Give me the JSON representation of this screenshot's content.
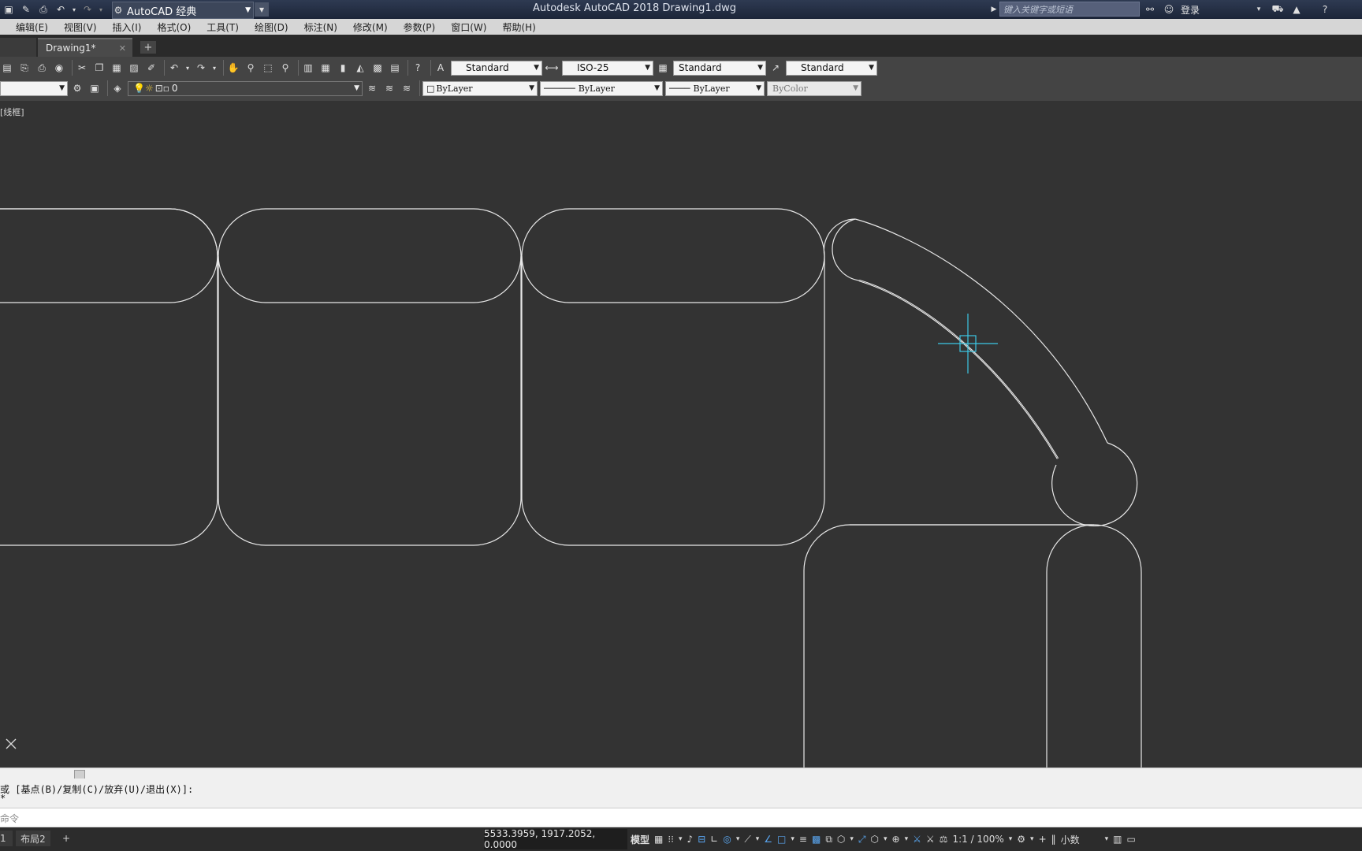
{
  "window": {
    "title": "Autodesk AutoCAD 2018    Drawing1.dwg",
    "workspace": "AutoCAD 经典",
    "search_placeholder": "键入关键字或短语",
    "login": "登录"
  },
  "menu": [
    "编辑(E)",
    "视图(V)",
    "插入(I)",
    "格式(O)",
    "工具(T)",
    "绘图(D)",
    "标注(N)",
    "修改(M)",
    "参数(P)",
    "窗口(W)",
    "帮助(H)"
  ],
  "tabs": {
    "active": "Drawing1*",
    "add": "+"
  },
  "styles": {
    "text_style": "Standard",
    "dim_style": "ISO-25",
    "table_style": "Standard",
    "multileader_style": "Standard"
  },
  "layers": {
    "current": "0",
    "color": "ByLayer",
    "linetype": "ByLayer",
    "lineweight": "ByLayer",
    "plotstyle": "ByColor"
  },
  "viewport_label": "[线框]",
  "command": {
    "line1": "或 [基点(B)/复制(C)/放弃(U)/退出(X)]:",
    "line2": "*",
    "input_prompt": "命令"
  },
  "layouts": {
    "layout1_fragment": "1",
    "layout2": "布局2",
    "add": "+"
  },
  "status": {
    "coordinates": "5533.3959, 1917.2052, 0.0000",
    "model": "模型",
    "scale": "1:1 / 100%",
    "units": "小数"
  },
  "colors": {
    "background": "#333333",
    "geometry": "#e8e8e8",
    "cursor": "#3cc8e6"
  }
}
